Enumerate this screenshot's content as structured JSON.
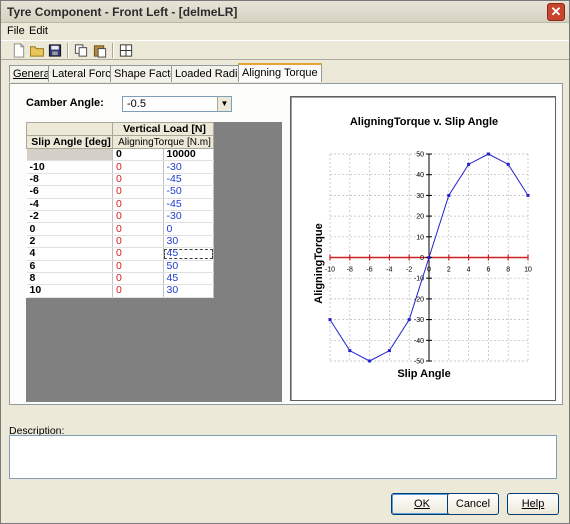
{
  "window": {
    "title": "Tyre Component - Front Left - [delmeLR]",
    "close_label": "✕"
  },
  "menu": {
    "items": [
      "File",
      "Edit"
    ]
  },
  "toolbar": {
    "icons": [
      "new-document-icon",
      "open-folder-icon",
      "save-icon",
      "copy-icon",
      "paste-icon",
      "grid-icon"
    ]
  },
  "tabs": [
    "General",
    "Lateral Force",
    "Shape Factor",
    "Loaded Radius",
    "Aligning Torque"
  ],
  "active_tab": "Aligning Torque",
  "camber": {
    "label": "Camber Angle:",
    "value": "-0.5"
  },
  "grid": {
    "header_top": "Vertical Load [N]",
    "header_left": "Slip Angle [deg]",
    "header_sub": "AligningTorque [N.m]",
    "load_index": "0",
    "load_value": "10000",
    "rows": [
      {
        "slip": "-10",
        "idx": "0",
        "torque": "-30"
      },
      {
        "slip": "-8",
        "idx": "0",
        "torque": "-45"
      },
      {
        "slip": "-6",
        "idx": "0",
        "torque": "-50"
      },
      {
        "slip": "-4",
        "idx": "0",
        "torque": "-45"
      },
      {
        "slip": "-2",
        "idx": "0",
        "torque": "-30"
      },
      {
        "slip": "0",
        "idx": "0",
        "torque": "0"
      },
      {
        "slip": "2",
        "idx": "0",
        "torque": "30"
      },
      {
        "slip": "4",
        "idx": "0",
        "torque": "45"
      },
      {
        "slip": "6",
        "idx": "0",
        "torque": "50"
      },
      {
        "slip": "8",
        "idx": "0",
        "torque": "45"
      },
      {
        "slip": "10",
        "idx": "0",
        "torque": "30"
      }
    ]
  },
  "chart_data": {
    "type": "line",
    "title": "AligningTorque v. Slip Angle",
    "xlabel": "Slip Angle",
    "ylabel": "AligningTorque",
    "x": [
      -10,
      -8,
      -6,
      -4,
      -2,
      0,
      2,
      4,
      6,
      8,
      10
    ],
    "y": [
      -30,
      -45,
      -50,
      -45,
      -30,
      0,
      30,
      45,
      50,
      45,
      30
    ],
    "xlim": [
      -10,
      10
    ],
    "ylim": [
      -50,
      50
    ],
    "xticks": [
      "-10",
      "-8",
      "-6",
      "-4",
      "-2",
      "0",
      "2",
      "4",
      "6",
      "8",
      "10"
    ],
    "yticks": [
      "50",
      "40",
      "30",
      "20",
      "10",
      "0",
      "-10",
      "-20",
      "-30",
      "-40",
      "-50"
    ],
    "grid": true,
    "line_color": "#2222cc",
    "axis_marker_color": "#cc2222"
  },
  "description": {
    "label": "Description:",
    "value": ""
  },
  "buttons": {
    "ok": "OK",
    "cancel": "Cancel",
    "help": "Help"
  }
}
